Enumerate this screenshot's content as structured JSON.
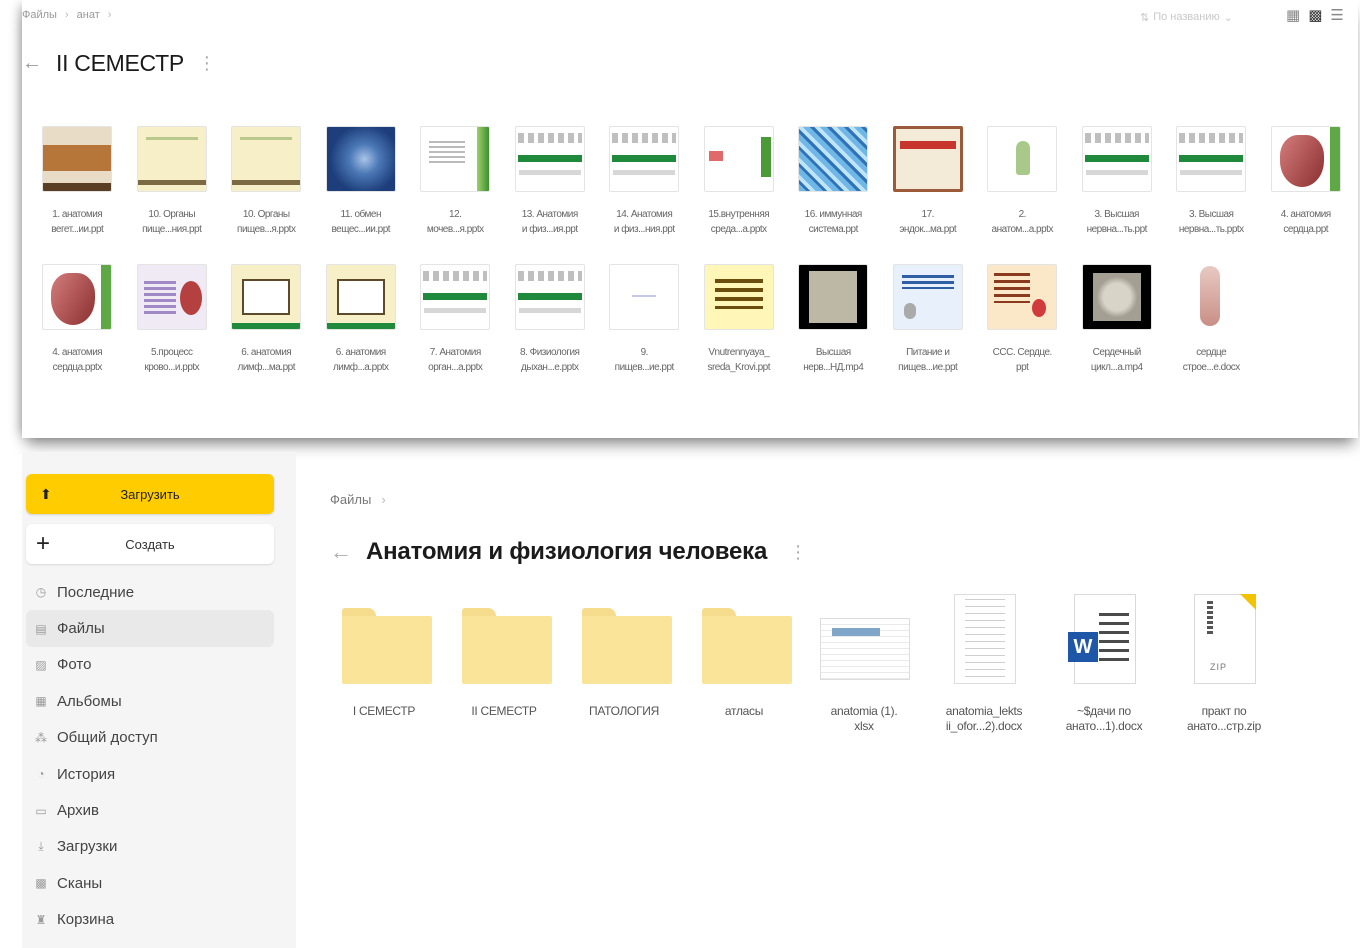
{
  "top": {
    "breadcrumb": [
      "Файлы",
      "анат"
    ],
    "sort_label": "По названию",
    "title": "II СЕМЕСТР",
    "row1": [
      {
        "name": "1. анатомия\nвегет...ии.ppt",
        "thumb": "brown"
      },
      {
        "name": "10. Органы\nпище...ния.ppt",
        "thumb": "cream"
      },
      {
        "name": "10. Органы\nпищев...я.pptx",
        "thumb": "cream"
      },
      {
        "name": "11. обмен\nвещес...ии.ppt",
        "thumb": "blue"
      },
      {
        "name": "12.\nмочев...я.pptx",
        "thumb": "green-right"
      },
      {
        "name": "13. Анатомия\nи физ...ия.ppt",
        "thumb": "table"
      },
      {
        "name": "14. Анатомия\nи физ...ния.ppt",
        "thumb": "table"
      },
      {
        "name": "15.внутренняя\nсреда...a.pptx",
        "thumb": "red-green"
      },
      {
        "name": "16. иммунная\nсистема.ppt",
        "thumb": "pattern"
      },
      {
        "name": "17.\nэндок...ма.ppt",
        "thumb": "framed"
      },
      {
        "name": "2.\nанатом...a.pptx",
        "thumb": "figure"
      },
      {
        "name": "3. Высшая\nнервна...ть.ppt",
        "thumb": "table"
      },
      {
        "name": "3. Высшая\nнервна...ть.pptx",
        "thumb": "table"
      },
      {
        "name": "4. анатомия\nсердца.ppt",
        "thumb": "heart"
      }
    ],
    "row2": [
      {
        "name": "4. анатомия\nсердца.pptx",
        "thumb": "heart"
      },
      {
        "name": "5.процесс\nкрово...и.pptx",
        "thumb": "lilac"
      },
      {
        "name": "6. анатомия\nлимф...ма.ppt",
        "thumb": "box"
      },
      {
        "name": "6. анатомия\nлимф...а.pptx",
        "thumb": "box"
      },
      {
        "name": "7. Анатомия\nорган...a.pptx",
        "thumb": "table"
      },
      {
        "name": "8. Физиология\nдыхан...e.pptx",
        "thumb": "table"
      },
      {
        "name": "9.\nпищев...ие.ppt",
        "thumb": "blank"
      },
      {
        "name": "Vnutrennyaya_\nsreda_Krovi.ppt",
        "thumb": "yellow"
      },
      {
        "name": "Высшая\nнерв...НД.mp4",
        "thumb": "video"
      },
      {
        "name": "Питание и\nпищев...ие.ppt",
        "thumb": "lightblue"
      },
      {
        "name": "ССС. Сердце.\nppt",
        "thumb": "peach"
      },
      {
        "name": "Сердечный\nцикл...a.mp4",
        "thumb": "cells"
      },
      {
        "name": "сердце\nстрое...e.docx",
        "thumb": "anatomy"
      }
    ]
  },
  "sidebar": {
    "upload_label": "Загрузить",
    "create_label": "Создать",
    "items": [
      {
        "label": "Последние",
        "icon": "clock-icon",
        "glyph": "◷"
      },
      {
        "label": "Файлы",
        "icon": "file-icon",
        "glyph": "▤"
      },
      {
        "label": "Фото",
        "icon": "photo-icon",
        "glyph": "▨"
      },
      {
        "label": "Альбомы",
        "icon": "albums-icon",
        "glyph": "▦"
      },
      {
        "label": "Общий доступ",
        "icon": "shared-icon",
        "glyph": "⁂"
      },
      {
        "label": "История",
        "icon": "history-icon",
        "glyph": "◔"
      },
      {
        "label": "Архив",
        "icon": "archive-icon",
        "glyph": "▭"
      },
      {
        "label": "Загрузки",
        "icon": "downloads-icon",
        "glyph": "⤓"
      },
      {
        "label": "Сканы",
        "icon": "scans-icon",
        "glyph": "▩"
      },
      {
        "label": "Корзина",
        "icon": "trash-icon",
        "glyph": "♜"
      }
    ],
    "active_index": 1
  },
  "main": {
    "breadcrumb": "Файлы",
    "title": "Анатомия и физиология человека",
    "files": [
      {
        "name": "I СЕМЕСТР",
        "type": "folder"
      },
      {
        "name": "II СЕМЕСТР",
        "type": "folder"
      },
      {
        "name": "ПАТОЛОГИЯ",
        "type": "folder"
      },
      {
        "name": "атласы",
        "type": "folder"
      },
      {
        "name": "anatomia (1).\nxlsx",
        "type": "xlsx"
      },
      {
        "name": "anatomia_lekts\nii_ofor...2).docx",
        "type": "docx1"
      },
      {
        "name": "~$дачи по\nанато...1).docx",
        "type": "docx2"
      },
      {
        "name": "практ по\nанато...стр.zip",
        "type": "zip"
      }
    ]
  },
  "colors": {
    "accent": "#ffcc00",
    "folder": "#fae49a",
    "word": "#1e56a8"
  }
}
